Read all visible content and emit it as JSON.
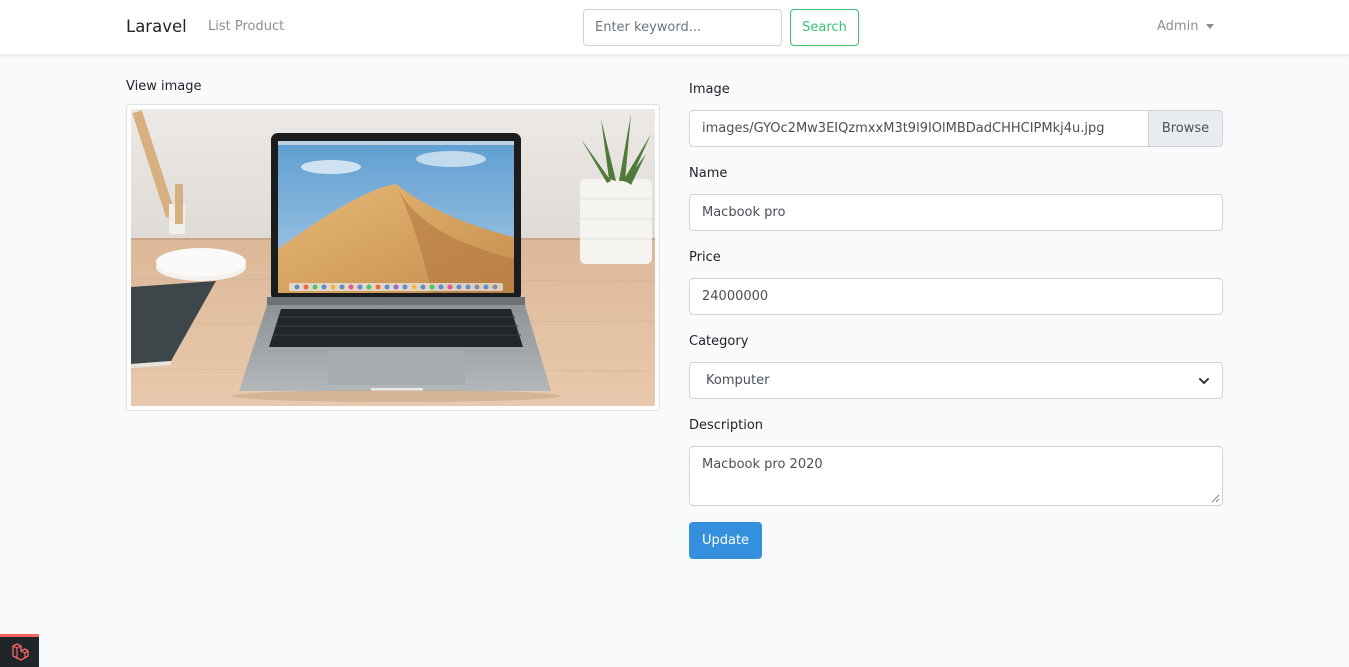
{
  "navbar": {
    "brand": "Laravel",
    "nav_link": "List Product",
    "search_placeholder": "Enter keyword...",
    "search_label": "Search",
    "user_menu": "Admin"
  },
  "preview": {
    "label": "View image"
  },
  "form": {
    "image_label": "Image",
    "image_value": "images/GYOc2Mw3EIQzmxxM3t9l9IOlMBDadCHHCIPMkj4u.jpg",
    "browse_label": "Browse",
    "name_label": "Name",
    "name_value": "Macbook pro",
    "price_label": "Price",
    "price_value": "24000000",
    "category_label": "Category",
    "category_value": "Komputer",
    "description_label": "Description",
    "description_value": "Macbook pro 2020",
    "update_label": "Update"
  },
  "colors": {
    "success": "#38c172",
    "primary": "#3490dc",
    "background": "#f8fafc"
  },
  "icons": {
    "user_menu": "caret-down-icon",
    "category": "chevron-down-icon",
    "debugbar": "laravel-logo-icon"
  }
}
